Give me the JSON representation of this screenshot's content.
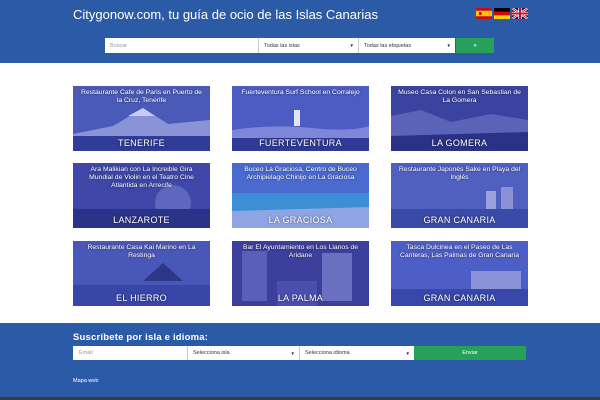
{
  "header": {
    "title": "Citygonow.com, tu guía de ocio de las Islas Canarias",
    "flags": [
      {
        "name": "spanish-flag-icon"
      },
      {
        "name": "german-flag-icon"
      },
      {
        "name": "uk-flag-icon"
      }
    ]
  },
  "search": {
    "placeholder": "Buscar",
    "islands_select": "Todas las islas",
    "tags_select": "Todas las etiquetas",
    "button_label": "»"
  },
  "cards": [
    {
      "caption": "Restaurante Cafe de Paris en Puerto de la Cruz, Tenerife",
      "island": "TENERIFE"
    },
    {
      "caption": "Fuerteventura Surf School en Corralejo",
      "island": "FUERTEVENTURA"
    },
    {
      "caption": "Museo Casa Colon en San Sebastian de La Gomera",
      "island": "LA GOMERA"
    },
    {
      "caption": "Ara Malikian con La Increible Gira Mundial de Violin en el Teatro Cine Atlantida en Arrecife",
      "island": "LANZAROTE"
    },
    {
      "caption": "Buceo La Graciosa, Centro de Buceo Archipielago Chinijo en La Graciosa",
      "island": "LA GRACIOSA"
    },
    {
      "caption": "Restaurante Japonés Sake en Playa del Inglés",
      "island": "GRAN CANARIA"
    },
    {
      "caption": "Restaurante Casa Kai Marino en La Restinga",
      "island": "EL HIERRO"
    },
    {
      "caption": "Bar El Ayuntamiento en Los Llanos de Aridane",
      "island": "LA PALMA"
    },
    {
      "caption": "Tasca Dulcinea en el Paseo de Las Canteras, Las Palmas de Gran Canaria",
      "island": "GRAN CANARIA"
    }
  ],
  "subscribe": {
    "title": "Suscríbete por isla e idioma:",
    "email_placeholder": "Email",
    "island_select": "Selecciona isla",
    "language_select": "Selecciona idioma",
    "send_label": "Enviar"
  },
  "footer": {
    "sitemap": "Mapa web"
  },
  "colors": {
    "brand_blue": "#2b5aa6",
    "button_green": "#27a05a",
    "card_overlay": "#3a4aaa"
  }
}
